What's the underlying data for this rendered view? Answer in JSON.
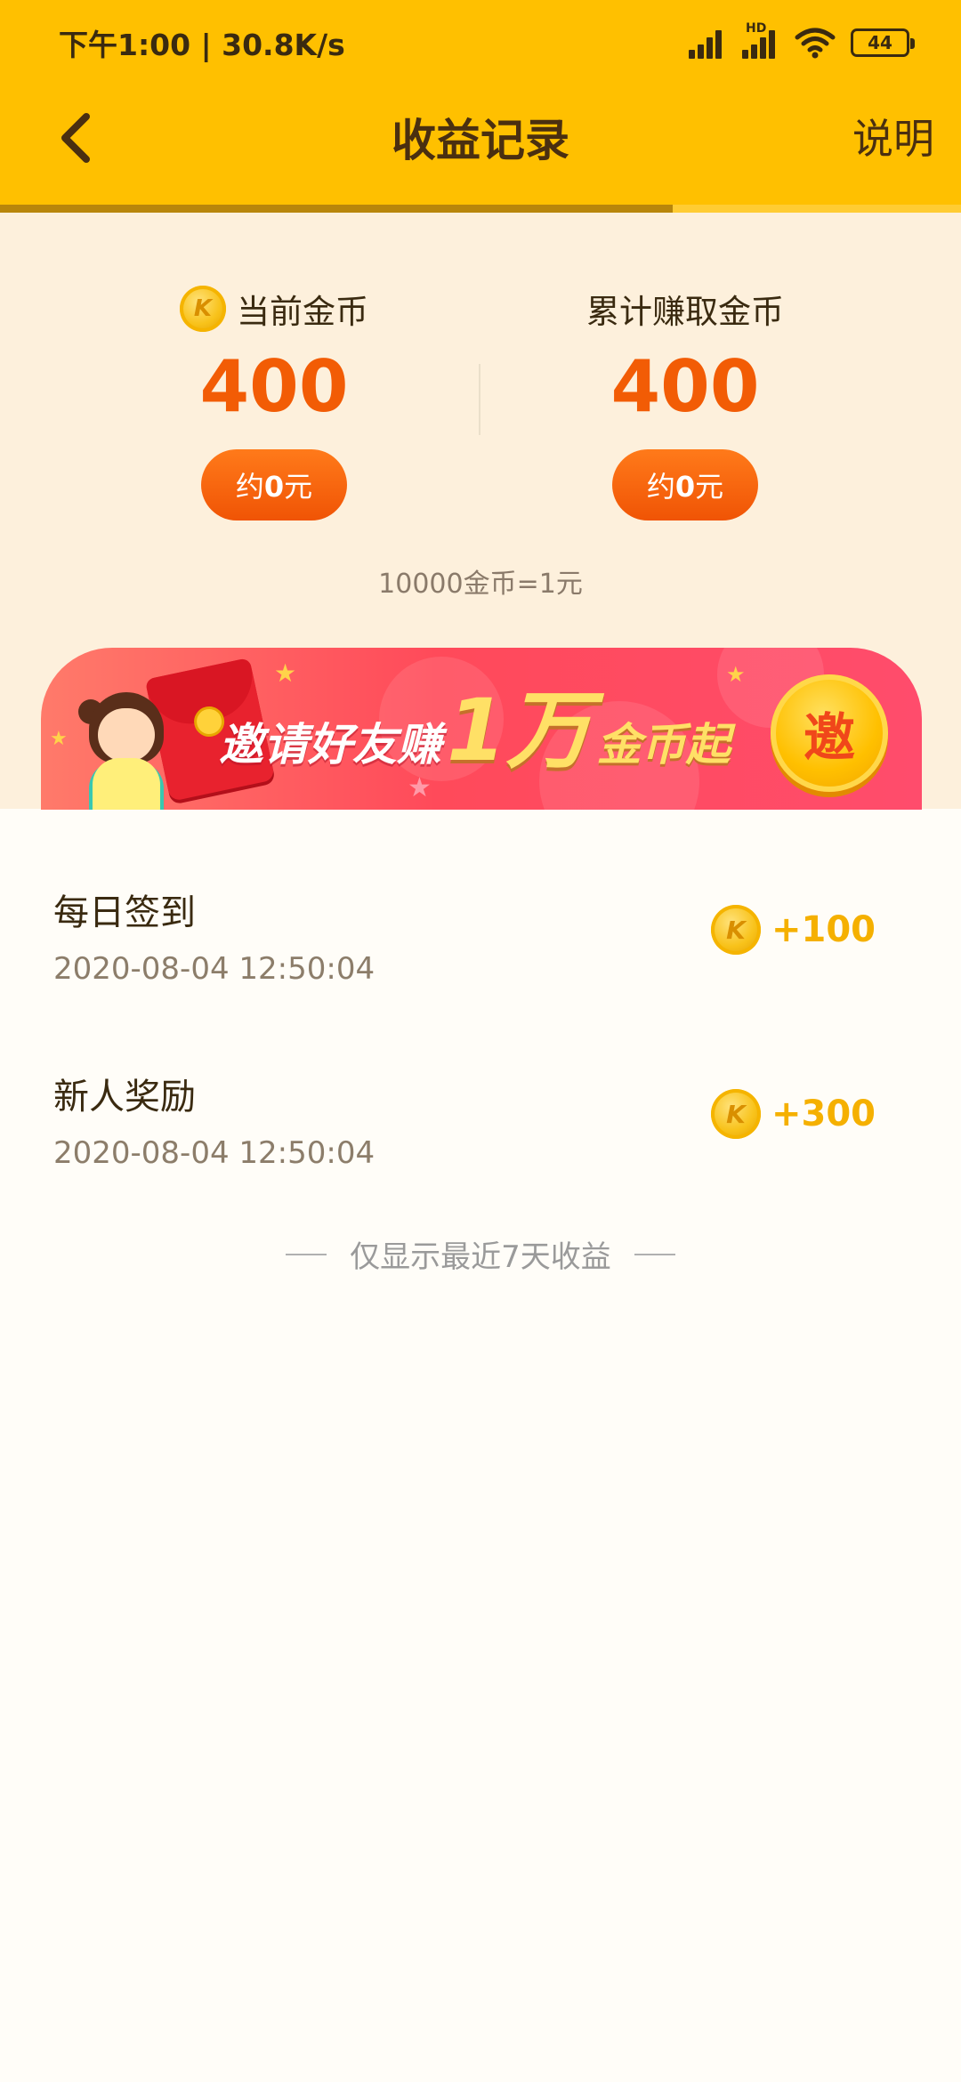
{
  "status_bar": {
    "time_speed": "下午1:00 | 30.8K/s",
    "hd_label": "HD",
    "battery": "44"
  },
  "nav": {
    "title": "收益记录",
    "help": "说明"
  },
  "load_progress": 0.7,
  "summary": {
    "current": {
      "label": "当前金币",
      "value": "400",
      "approx_prefix": "约",
      "approx_amount": "0",
      "approx_suffix": "元"
    },
    "total": {
      "label": "累计赚取金币",
      "value": "400",
      "approx_prefix": "约",
      "approx_amount": "0",
      "approx_suffix": "元"
    },
    "rate": "10000金币=1元"
  },
  "banner": {
    "text_invite": "邀请好友赚",
    "text_amount": "1万",
    "text_tail": "金币起",
    "button": "邀"
  },
  "coin_letter": "K",
  "records": [
    {
      "title": "每日签到",
      "time": "2020-08-04 12:50:04",
      "amount": "+100"
    },
    {
      "title": "新人奖励",
      "time": "2020-08-04 12:50:04",
      "amount": "+300"
    }
  ],
  "footer_note": "仅显示最近7天收益",
  "colors": {
    "header": "#ffc000",
    "accent_orange": "#f25c05",
    "coin_amount": "#f5b000",
    "summary_bg": "#fdf0dc"
  }
}
